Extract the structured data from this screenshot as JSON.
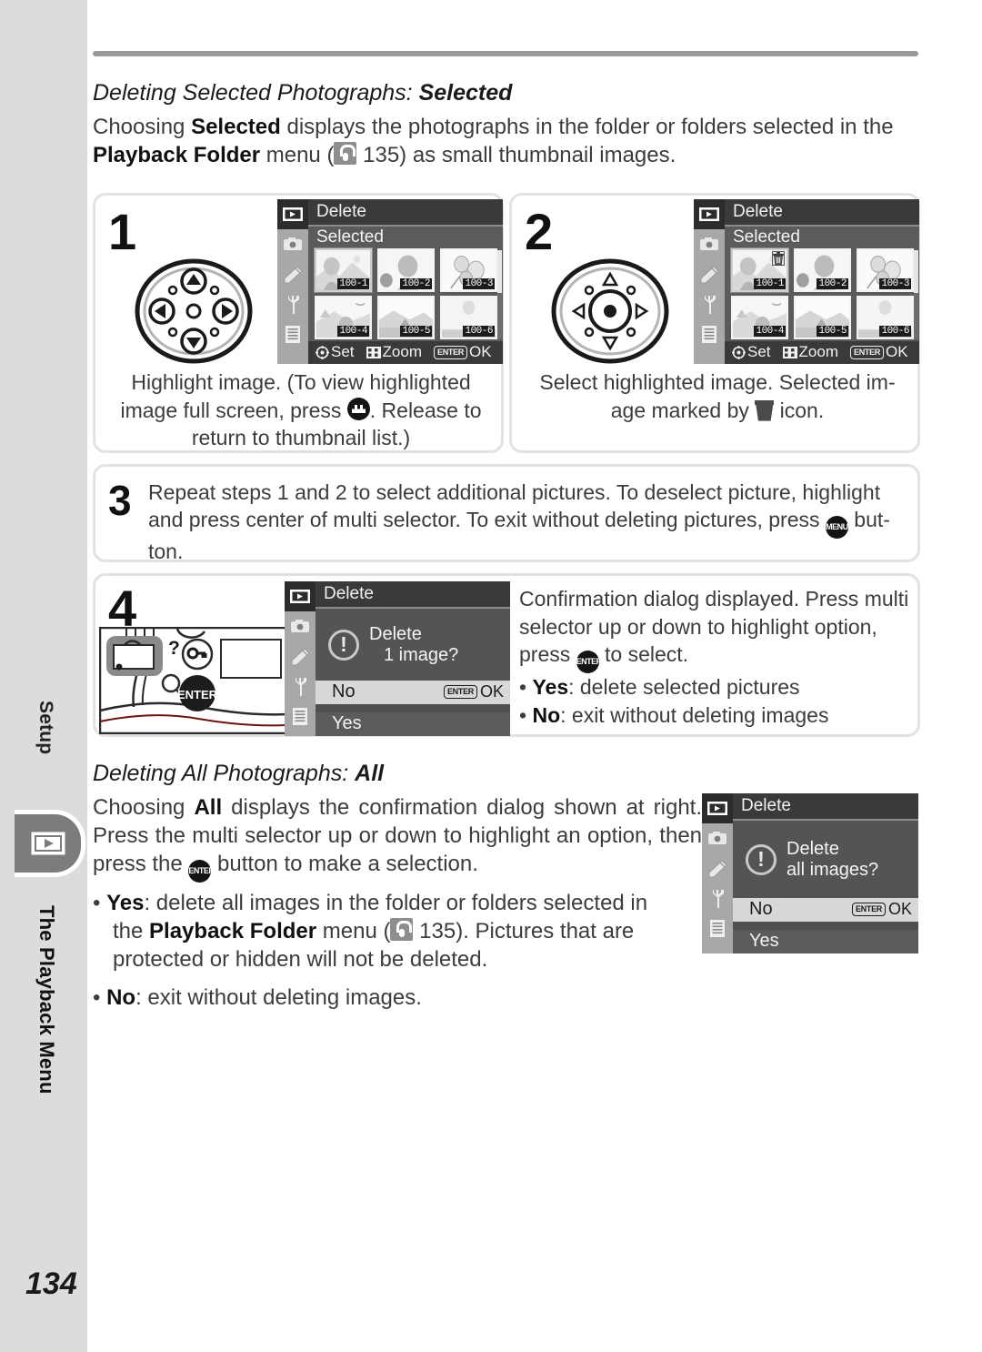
{
  "page": {
    "number": "134",
    "sidebar": {
      "above_label": "Setup",
      "section_title": "The Playback Menu",
      "tab_icon": "playback-icon"
    }
  },
  "section_selected": {
    "heading_italic": "Deleting Selected Photographs:",
    "heading_bold": "Selected",
    "intro_line1_a": "Choosing ",
    "intro_line1_b": "Selected",
    "intro_line1_c": " displays the photographs in the folder or folders selected in",
    "intro_line2_a": "the ",
    "intro_line2_b": "Playback Folder",
    "intro_line2_c": " menu (",
    "intro_ref": "135",
    "intro_line2_d": ") as small thumbnail images."
  },
  "steps": [
    {
      "number": "1",
      "caption_line1": "Highlight image.  (To view highlighted",
      "caption_line2_a": "image full screen, press ",
      "caption_line2_b": ".  Release to",
      "caption_line3": "return to thumbnail list.)",
      "dial": "multi-selector-arrows",
      "lcd": {
        "title": "Delete",
        "subtitle": "Selected",
        "thumbnails": [
          "100-1",
          "100-2",
          "100-3",
          "100-4",
          "100-5",
          "100-6"
        ],
        "selected_index": 0,
        "marked": [],
        "footer": {
          "set": "Set",
          "zoom": "Zoom",
          "enter": "ENTER",
          "ok": "OK"
        }
      }
    },
    {
      "number": "2",
      "caption_line1": "Select highlighted image.  Selected im-",
      "caption_line2_a": "age marked by ",
      "caption_line2_b": " icon.",
      "dial": "multi-selector-center",
      "lcd": {
        "title": "Delete",
        "subtitle": "Selected",
        "thumbnails": [
          "100-1",
          "100-2",
          "100-3",
          "100-4",
          "100-5",
          "100-6"
        ],
        "selected_index": 0,
        "marked": [
          0
        ],
        "footer": {
          "set": "Set",
          "zoom": "Zoom",
          "enter": "ENTER",
          "ok": "OK"
        }
      }
    },
    {
      "number": "3",
      "text_line1": "Repeat steps 1 and 2 to select additional pictures.  To deselect picture, highlight",
      "text_line2_a": "and press center of multi selector.  To exit without deleting pictures, press ",
      "text_line2_b": " but-",
      "text_line3": "ton.",
      "menu_badge": "MENU"
    },
    {
      "number": "4",
      "text_line1": "Confirmation dialog displayed.  Press multi",
      "text_line2": "selector up or down to highlight option,",
      "text_line3_a": "press ",
      "text_line3_b": " to select.",
      "bullet_yes_label": "Yes",
      "bullet_yes_text": ": delete selected pictures",
      "bullet_no_label": "No",
      "bullet_no_text": ": exit without deleting images",
      "enter_badge": "ENTER",
      "camera": {
        "help_mark": "?",
        "enter_label": "ENTER",
        "zoom_mark": "Q",
        "highlight_button": "playback-monitor-button"
      },
      "lcd": {
        "title": "Delete",
        "message_line1": "Delete",
        "message_line2": "1 image?",
        "option_highlighted": "No",
        "option_other": "Yes",
        "enter": "ENTER",
        "ok": "OK"
      }
    }
  ],
  "section_all": {
    "heading_italic": "Deleting All Photographs:",
    "heading_bold": "All",
    "p_line1_a": "Choosing ",
    "p_line1_b": "All",
    "p_line1_c": " displays the confirmation dialog shown at",
    "p_line2": "right.  Press the multi selector up or down to highlight an",
    "p_line3_a": "option, then press the ",
    "p_line3_b": " button to make a selection.",
    "enter_badge": "ENTER",
    "bullet_yes_label": "Yes",
    "bullet_yes_l1": ": delete all images in the folder or folders selected in",
    "bullet_yes_l2_a": "the ",
    "bullet_yes_l2_b": "Playback Folder",
    "bullet_yes_l2_c": " menu (",
    "bullet_yes_ref": "135",
    "bullet_yes_l2_d": ").  Pictures that are",
    "bullet_yes_l3": "protected or hidden will not be deleted.",
    "bullet_no_label": "No",
    "bullet_no_text": ": exit without deleting images.",
    "lcd": {
      "title": "Delete",
      "message_line1": "Delete",
      "message_line2": "all images?",
      "option_highlighted": "No",
      "option_other": "Yes",
      "enter": "ENTER",
      "ok": "OK"
    }
  },
  "lcd_rail_icons": [
    "playback-icon",
    "camera-icon",
    "pencil-icon",
    "wrench-icon",
    "list-icon"
  ],
  "colors": {
    "sidebar": "#dcdcdc",
    "tab": "#7c7c7c",
    "rule": "#9a9a9a",
    "lcd_bg": "#5b5b5b",
    "lcd_header": "#3a3a3a",
    "panel_border": "#e2e2e2",
    "text": "#3c3c3c"
  }
}
